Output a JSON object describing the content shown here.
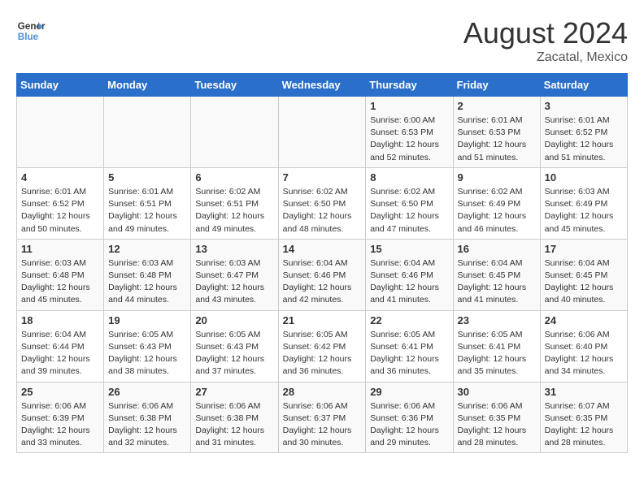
{
  "header": {
    "logo_line1": "General",
    "logo_line2": "Blue",
    "month_year": "August 2024",
    "location": "Zacatal, Mexico"
  },
  "weekdays": [
    "Sunday",
    "Monday",
    "Tuesday",
    "Wednesday",
    "Thursday",
    "Friday",
    "Saturday"
  ],
  "weeks": [
    [
      {
        "day": "",
        "detail": ""
      },
      {
        "day": "",
        "detail": ""
      },
      {
        "day": "",
        "detail": ""
      },
      {
        "day": "",
        "detail": ""
      },
      {
        "day": "1",
        "detail": "Sunrise: 6:00 AM\nSunset: 6:53 PM\nDaylight: 12 hours\nand 52 minutes."
      },
      {
        "day": "2",
        "detail": "Sunrise: 6:01 AM\nSunset: 6:53 PM\nDaylight: 12 hours\nand 51 minutes."
      },
      {
        "day": "3",
        "detail": "Sunrise: 6:01 AM\nSunset: 6:52 PM\nDaylight: 12 hours\nand 51 minutes."
      }
    ],
    [
      {
        "day": "4",
        "detail": "Sunrise: 6:01 AM\nSunset: 6:52 PM\nDaylight: 12 hours\nand 50 minutes."
      },
      {
        "day": "5",
        "detail": "Sunrise: 6:01 AM\nSunset: 6:51 PM\nDaylight: 12 hours\nand 49 minutes."
      },
      {
        "day": "6",
        "detail": "Sunrise: 6:02 AM\nSunset: 6:51 PM\nDaylight: 12 hours\nand 49 minutes."
      },
      {
        "day": "7",
        "detail": "Sunrise: 6:02 AM\nSunset: 6:50 PM\nDaylight: 12 hours\nand 48 minutes."
      },
      {
        "day": "8",
        "detail": "Sunrise: 6:02 AM\nSunset: 6:50 PM\nDaylight: 12 hours\nand 47 minutes."
      },
      {
        "day": "9",
        "detail": "Sunrise: 6:02 AM\nSunset: 6:49 PM\nDaylight: 12 hours\nand 46 minutes."
      },
      {
        "day": "10",
        "detail": "Sunrise: 6:03 AM\nSunset: 6:49 PM\nDaylight: 12 hours\nand 45 minutes."
      }
    ],
    [
      {
        "day": "11",
        "detail": "Sunrise: 6:03 AM\nSunset: 6:48 PM\nDaylight: 12 hours\nand 45 minutes."
      },
      {
        "day": "12",
        "detail": "Sunrise: 6:03 AM\nSunset: 6:48 PM\nDaylight: 12 hours\nand 44 minutes."
      },
      {
        "day": "13",
        "detail": "Sunrise: 6:03 AM\nSunset: 6:47 PM\nDaylight: 12 hours\nand 43 minutes."
      },
      {
        "day": "14",
        "detail": "Sunrise: 6:04 AM\nSunset: 6:46 PM\nDaylight: 12 hours\nand 42 minutes."
      },
      {
        "day": "15",
        "detail": "Sunrise: 6:04 AM\nSunset: 6:46 PM\nDaylight: 12 hours\nand 41 minutes."
      },
      {
        "day": "16",
        "detail": "Sunrise: 6:04 AM\nSunset: 6:45 PM\nDaylight: 12 hours\nand 41 minutes."
      },
      {
        "day": "17",
        "detail": "Sunrise: 6:04 AM\nSunset: 6:45 PM\nDaylight: 12 hours\nand 40 minutes."
      }
    ],
    [
      {
        "day": "18",
        "detail": "Sunrise: 6:04 AM\nSunset: 6:44 PM\nDaylight: 12 hours\nand 39 minutes."
      },
      {
        "day": "19",
        "detail": "Sunrise: 6:05 AM\nSunset: 6:43 PM\nDaylight: 12 hours\nand 38 minutes."
      },
      {
        "day": "20",
        "detail": "Sunrise: 6:05 AM\nSunset: 6:43 PM\nDaylight: 12 hours\nand 37 minutes."
      },
      {
        "day": "21",
        "detail": "Sunrise: 6:05 AM\nSunset: 6:42 PM\nDaylight: 12 hours\nand 36 minutes."
      },
      {
        "day": "22",
        "detail": "Sunrise: 6:05 AM\nSunset: 6:41 PM\nDaylight: 12 hours\nand 36 minutes."
      },
      {
        "day": "23",
        "detail": "Sunrise: 6:05 AM\nSunset: 6:41 PM\nDaylight: 12 hours\nand 35 minutes."
      },
      {
        "day": "24",
        "detail": "Sunrise: 6:06 AM\nSunset: 6:40 PM\nDaylight: 12 hours\nand 34 minutes."
      }
    ],
    [
      {
        "day": "25",
        "detail": "Sunrise: 6:06 AM\nSunset: 6:39 PM\nDaylight: 12 hours\nand 33 minutes."
      },
      {
        "day": "26",
        "detail": "Sunrise: 6:06 AM\nSunset: 6:38 PM\nDaylight: 12 hours\nand 32 minutes."
      },
      {
        "day": "27",
        "detail": "Sunrise: 6:06 AM\nSunset: 6:38 PM\nDaylight: 12 hours\nand 31 minutes."
      },
      {
        "day": "28",
        "detail": "Sunrise: 6:06 AM\nSunset: 6:37 PM\nDaylight: 12 hours\nand 30 minutes."
      },
      {
        "day": "29",
        "detail": "Sunrise: 6:06 AM\nSunset: 6:36 PM\nDaylight: 12 hours\nand 29 minutes."
      },
      {
        "day": "30",
        "detail": "Sunrise: 6:06 AM\nSunset: 6:35 PM\nDaylight: 12 hours\nand 28 minutes."
      },
      {
        "day": "31",
        "detail": "Sunrise: 6:07 AM\nSunset: 6:35 PM\nDaylight: 12 hours\nand 28 minutes."
      }
    ]
  ]
}
